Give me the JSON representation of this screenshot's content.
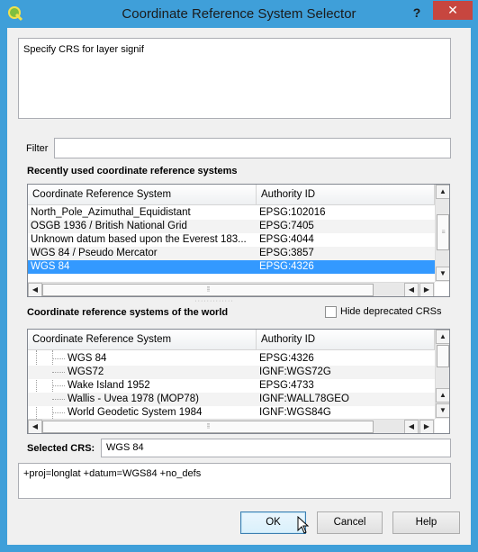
{
  "window": {
    "title": "Coordinate Reference System Selector",
    "help_label": "?",
    "close_label": "✕"
  },
  "description": "Specify CRS for layer signif",
  "filter": {
    "label": "Filter",
    "value": ""
  },
  "recent": {
    "heading": "Recently used coordinate reference systems",
    "columns": [
      "Coordinate Reference System",
      "Authority ID"
    ],
    "rows": [
      {
        "name": "North_Pole_Azimuthal_Equidistant",
        "id": "EPSG:102016"
      },
      {
        "name": "OSGB 1936 / British National Grid",
        "id": "EPSG:7405"
      },
      {
        "name": "Unknown datum based upon the Everest 183...",
        "id": "EPSG:4044"
      },
      {
        "name": "WGS 84 / Pseudo Mercator",
        "id": "EPSG:3857"
      },
      {
        "name": "WGS 84",
        "id": "EPSG:4326",
        "selected": true
      }
    ]
  },
  "world": {
    "heading": "Coordinate reference systems of the world",
    "hide_deprecated_label": "Hide deprecated CRSs",
    "hide_deprecated_checked": false,
    "columns": [
      "Coordinate Reference System",
      "Authority ID"
    ],
    "rows": [
      {
        "name": "WGS 84",
        "id": "EPSG:4326"
      },
      {
        "name": "WGS72",
        "id": "IGNF:WGS72G"
      },
      {
        "name": "Wake Island 1952",
        "id": "EPSG:4733"
      },
      {
        "name": "Wallis - Uvea 1978 (MOP78)",
        "id": "IGNF:WALL78GEO"
      },
      {
        "name": "World Geodetic System 1984",
        "id": "IGNF:WGS84G"
      }
    ]
  },
  "selected_crs": {
    "label": "Selected CRS:",
    "value": "WGS 84"
  },
  "proj_string": "+proj=longlat +datum=WGS84 +no_defs",
  "buttons": {
    "ok": "OK",
    "cancel": "Cancel",
    "help": "Help"
  },
  "colors": {
    "title_bar": "#3f9fd9",
    "close_button": "#c7463f",
    "selection": "#3399ff"
  }
}
